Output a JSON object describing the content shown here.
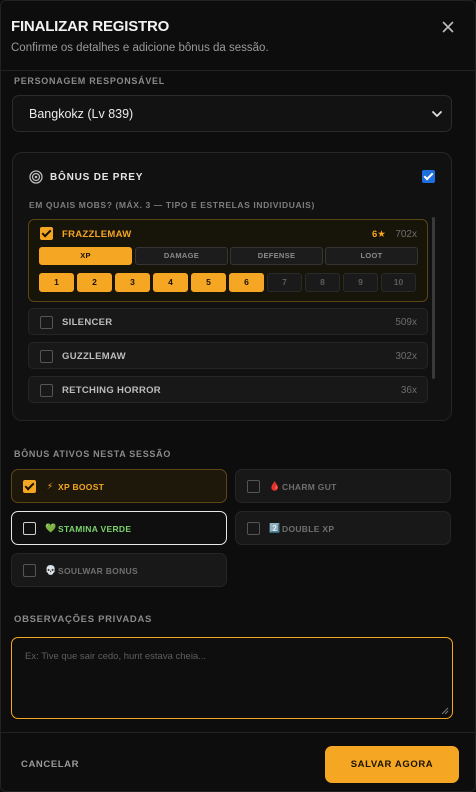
{
  "header": {
    "title": "FINALIZAR REGISTRO",
    "subtitle": "Confirme os detalhes e adicione bônus da sessão.",
    "close_icon": "close-icon"
  },
  "character": {
    "label": "PERSONAGEM RESPONSÁVEL",
    "selected": "Bangkokz (Lv 839)"
  },
  "prey": {
    "title": "BÔNUS DE PREY",
    "enabled": true,
    "subtitle": "EM QUAIS MOBS? (MÁX. 3 — TIPO E ESTRELAS INDIVIDUAIS)",
    "selected_mob": {
      "name": "FRAZZLEMAW",
      "stars": "6★",
      "count": "702x",
      "types": [
        "XP",
        "DAMAGE",
        "DEFENSE",
        "LOOT"
      ],
      "active_type": "XP",
      "star_levels": [
        "1",
        "2",
        "3",
        "4",
        "5",
        "6",
        "7",
        "8",
        "9",
        "10"
      ],
      "active_star": 6
    },
    "mobs": [
      {
        "name": "SILENCER",
        "count": "509x"
      },
      {
        "name": "GUZZLEMAW",
        "count": "302x"
      },
      {
        "name": "RETCHING HORROR",
        "count": "36x"
      }
    ]
  },
  "bonuses": {
    "label": "BÔNUS ATIVOS NESTA SESSÃO",
    "items": [
      {
        "label": "XP BOOST",
        "emoji": "⚡",
        "checked": true
      },
      {
        "label": "CHARM GUT",
        "emoji": "🩸",
        "checked": false
      },
      {
        "label": "STAMINA VERDE",
        "emoji": "💚",
        "checked": false
      },
      {
        "label": "DOUBLE XP",
        "emoji": "2️⃣",
        "checked": false
      },
      {
        "label": "SOULWAR BONUS",
        "emoji": "💀",
        "checked": false
      }
    ]
  },
  "notes": {
    "label": "OBSERVAÇÕES PRIVADAS",
    "placeholder": "Ex: Tive que sair cedo, hunt estava cheia..."
  },
  "footer": {
    "cancel_label": "CANCELAR",
    "save_label": "SALVAR AGORA"
  },
  "colors": {
    "accent": "#f5a623",
    "checkbox_blue": "#1d6fe0",
    "stamina_green": "#7bd36a"
  }
}
